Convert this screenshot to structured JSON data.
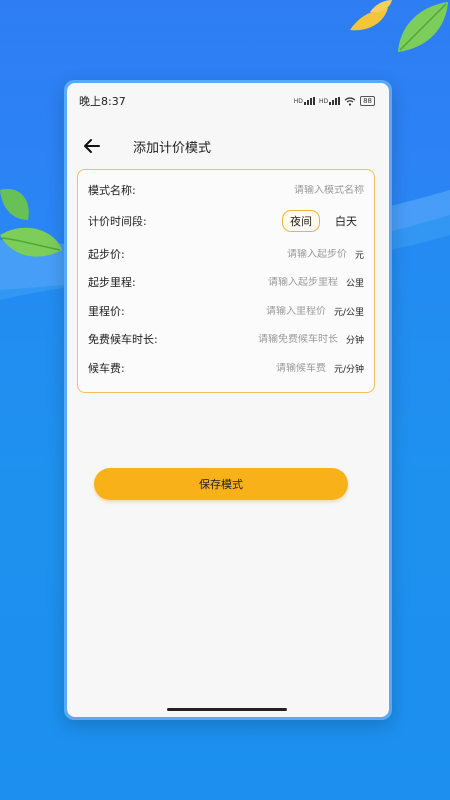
{
  "status_bar": {
    "time": "晚上8:37",
    "signal1": "HD",
    "signal2": "HD",
    "battery": "88"
  },
  "header": {
    "title": "添加计价模式"
  },
  "form": {
    "mode_name": {
      "label": "模式名称:",
      "placeholder": "请输入模式名称"
    },
    "time_period": {
      "label": "计价时间段:",
      "options": [
        "夜间",
        "白天"
      ],
      "selected": "夜间"
    },
    "start_price": {
      "label": "起步价:",
      "placeholder": "请输入起步价",
      "unit": "元"
    },
    "start_mileage": {
      "label": "起步里程:",
      "placeholder": "请输入起步里程",
      "unit": "公里"
    },
    "mileage_price": {
      "label": "里程价:",
      "placeholder": "请输入里程价",
      "unit": "元/公里"
    },
    "free_wait": {
      "label": "免费候车时长:",
      "placeholder": "请输免费候车时长",
      "unit": "分钟"
    },
    "wait_fee": {
      "label": "候车费:",
      "placeholder": "请输候车费",
      "unit": "元/分钟"
    }
  },
  "save_button": {
    "label": "保存模式"
  },
  "colors": {
    "accent": "#f9b11a",
    "card_border": "#f1c15a",
    "background": "#2a86f5"
  }
}
